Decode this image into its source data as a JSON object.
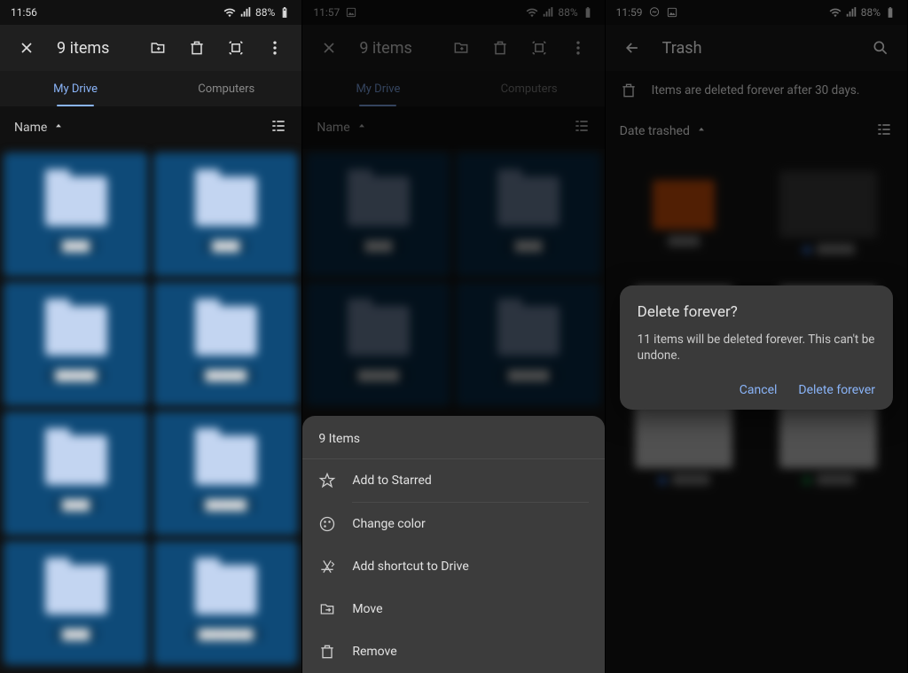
{
  "pane1": {
    "status": {
      "time": "11:56",
      "battery": "88%"
    },
    "header": {
      "title": "9 items"
    },
    "tabs": {
      "my_drive": "My Drive",
      "computers": "Computers"
    },
    "sort": {
      "label": "Name"
    },
    "folders": [
      "",
      "",
      "",
      "",
      "",
      "",
      "",
      ""
    ]
  },
  "pane2": {
    "status": {
      "time": "11:57",
      "battery": "88%"
    },
    "header": {
      "title": "9 items"
    },
    "tabs": {
      "my_drive": "My Drive",
      "computers": "Computers"
    },
    "sort": {
      "label": "Name"
    },
    "folders": [
      "",
      "",
      "",
      ""
    ],
    "sheet": {
      "title": "9 Items",
      "items": {
        "starred": "Add to Starred",
        "color": "Change color",
        "shortcut": "Add shortcut to Drive",
        "move": "Move",
        "remove": "Remove"
      }
    }
  },
  "pane3": {
    "status": {
      "time": "11:59",
      "battery": "88%"
    },
    "header": {
      "title": "Trash"
    },
    "info": "Items are deleted forever after 30 days.",
    "sort": {
      "label": "Date trashed"
    },
    "dialog": {
      "title": "Delete forever?",
      "body": "11 items will be deleted forever. This can't be undone.",
      "cancel": "Cancel",
      "confirm": "Delete forever"
    }
  }
}
